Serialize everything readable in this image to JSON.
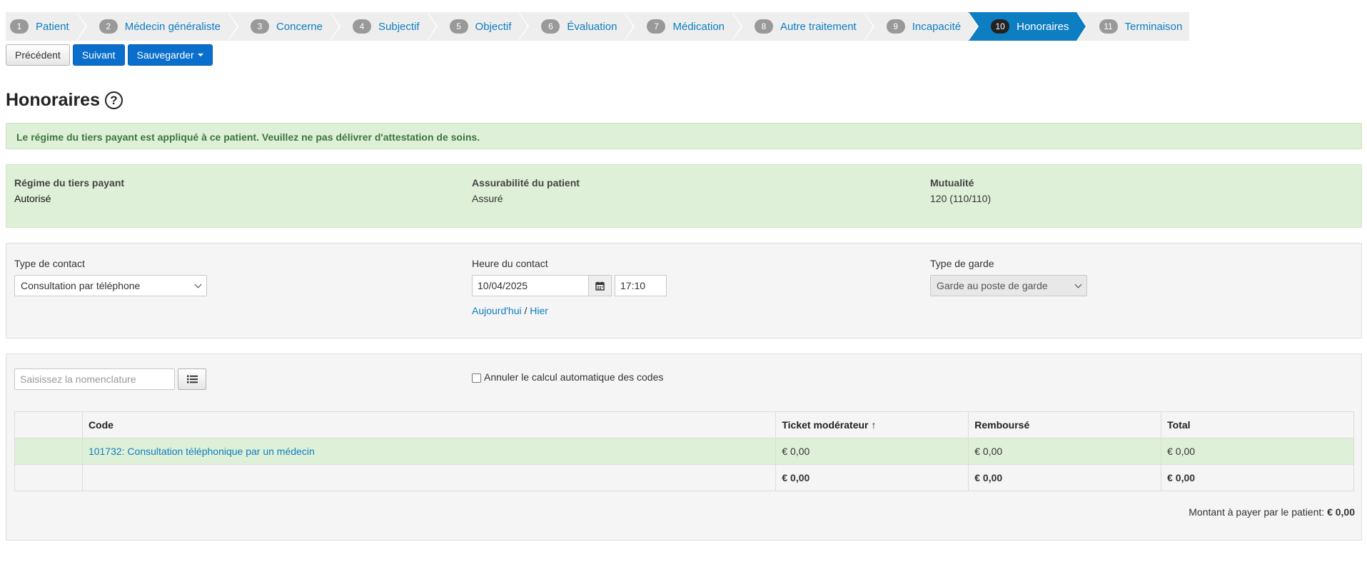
{
  "wizard": {
    "steps": [
      {
        "num": "1",
        "label": "Patient"
      },
      {
        "num": "2",
        "label": "Médecin généraliste"
      },
      {
        "num": "3",
        "label": "Concerne"
      },
      {
        "num": "4",
        "label": "Subjectif"
      },
      {
        "num": "5",
        "label": "Objectif"
      },
      {
        "num": "6",
        "label": "Évaluation"
      },
      {
        "num": "7",
        "label": "Médication"
      },
      {
        "num": "8",
        "label": "Autre traitement"
      },
      {
        "num": "9",
        "label": "Incapacité"
      },
      {
        "num": "10",
        "label": "Honoraires"
      },
      {
        "num": "11",
        "label": "Terminaison"
      }
    ],
    "active_index": 9
  },
  "toolbar": {
    "previous": "Précédent",
    "next": "Suivant",
    "save": "Sauvegarder"
  },
  "page": {
    "title": "Honoraires",
    "help_glyph": "?"
  },
  "alert": {
    "text": "Le régime du tiers payant est appliqué à ce patient. Veuillez ne pas délivrer d'attestation de soins."
  },
  "patient_info": {
    "tiers_label": "Régime du tiers payant",
    "tiers_value": "Autorisé",
    "insurability_label": "Assurabilité du patient",
    "insurability_value": "Assuré",
    "mutuality_label": "Mutualité",
    "mutuality_value": "120 (110/110)"
  },
  "contact": {
    "type_label": "Type de contact",
    "type_value": "Consultation par téléphone",
    "time_label": "Heure du contact",
    "date_value": "10/04/2025",
    "time_value": "17:10",
    "today_link": "Aujourd'hui",
    "separator": "/",
    "yesterday_link": "Hier",
    "garde_label": "Type de garde",
    "garde_value": "Garde au poste de garde"
  },
  "codes": {
    "search_placeholder": "Saisissez la nomenclature",
    "cancel_auto_label": "Annuler le calcul automatique des codes",
    "headers": {
      "code": "Code",
      "ticket": "Ticket modérateur",
      "sort_arrow": "↑",
      "reimbursed": "Remboursé",
      "total": "Total"
    },
    "rows": [
      {
        "code": "101732: Consultation téléphonique par un médecin",
        "ticket": "€ 0,00",
        "reimbursed": "€ 0,00",
        "total": "€ 0,00"
      }
    ],
    "totals": {
      "ticket": "€ 0,00",
      "reimbursed": "€ 0,00",
      "total": "€ 0,00"
    },
    "amount_label": "Montant à payer par le patient:",
    "amount_value": "€ 0,00"
  },
  "colors": {
    "accent": "#0e7ec2",
    "primary_button": "#0a6fcc",
    "success_bg": "#dff0d8",
    "success_text": "#3c763d"
  }
}
